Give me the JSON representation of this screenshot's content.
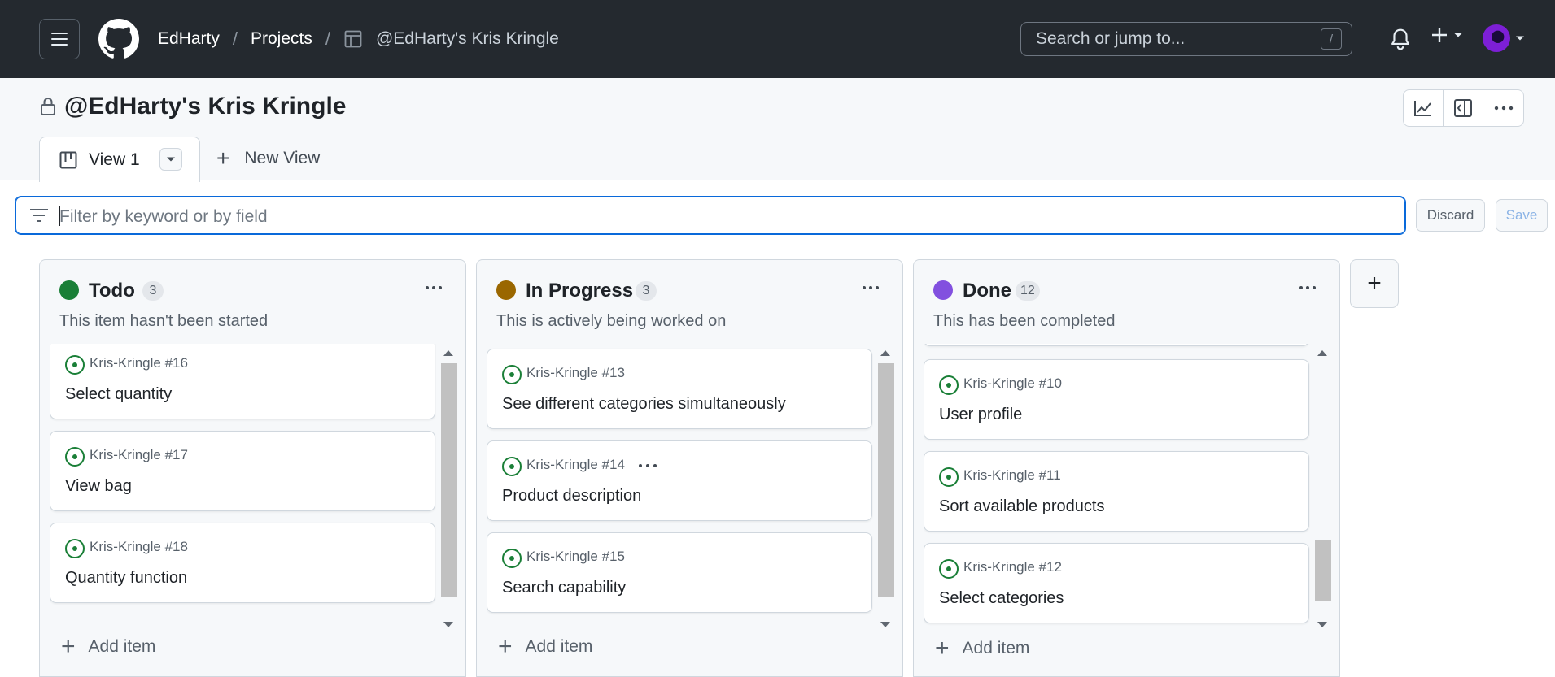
{
  "header": {
    "breadcrumbs": [
      {
        "label": "EdHarty"
      },
      {
        "label": "Projects"
      },
      {
        "label": "@EdHarty's Kris Kringle"
      }
    ],
    "search_placeholder": "Search or jump to...",
    "search_shortcut": "/"
  },
  "project": {
    "title": "@EdHarty's Kris Kringle",
    "tabs": [
      {
        "label": "View 1",
        "active": true
      }
    ],
    "new_view_label": "New View"
  },
  "filter": {
    "placeholder": "Filter by keyword or by field",
    "discard_label": "Discard",
    "save_label": "Save"
  },
  "columns": [
    {
      "name": "Todo",
      "count": "3",
      "color": "#1a7f37",
      "description": "This item hasn't been started",
      "add_item_label": "Add item",
      "cards": [
        {
          "ref": "Kris-Kringle #16",
          "title": "Select quantity"
        },
        {
          "ref": "Kris-Kringle #17",
          "title": "View bag"
        },
        {
          "ref": "Kris-Kringle #18",
          "title": "Quantity function"
        }
      ]
    },
    {
      "name": "In Progress",
      "count": "3",
      "color": "#9a6700",
      "description": "This is actively being worked on",
      "add_item_label": "Add item",
      "cards": [
        {
          "ref": "Kris-Kringle #13",
          "title": "See different categories simultaneously"
        },
        {
          "ref": "Kris-Kringle #14",
          "title": "Product description"
        },
        {
          "ref": "Kris-Kringle #15",
          "title": "Search capability"
        }
      ]
    },
    {
      "name": "Done",
      "count": "12",
      "color": "#8250df",
      "description": "This has been completed",
      "add_item_label": "Add item",
      "cards": [
        {
          "ref": "Kris-Kringle #10",
          "title": "User profile"
        },
        {
          "ref": "Kris-Kringle #11",
          "title": "Sort available products"
        },
        {
          "ref": "Kris-Kringle #12",
          "title": "Select categories"
        }
      ]
    }
  ],
  "icons": {
    "status": "issue-open-icon",
    "issue_color": "#1a7f37"
  }
}
